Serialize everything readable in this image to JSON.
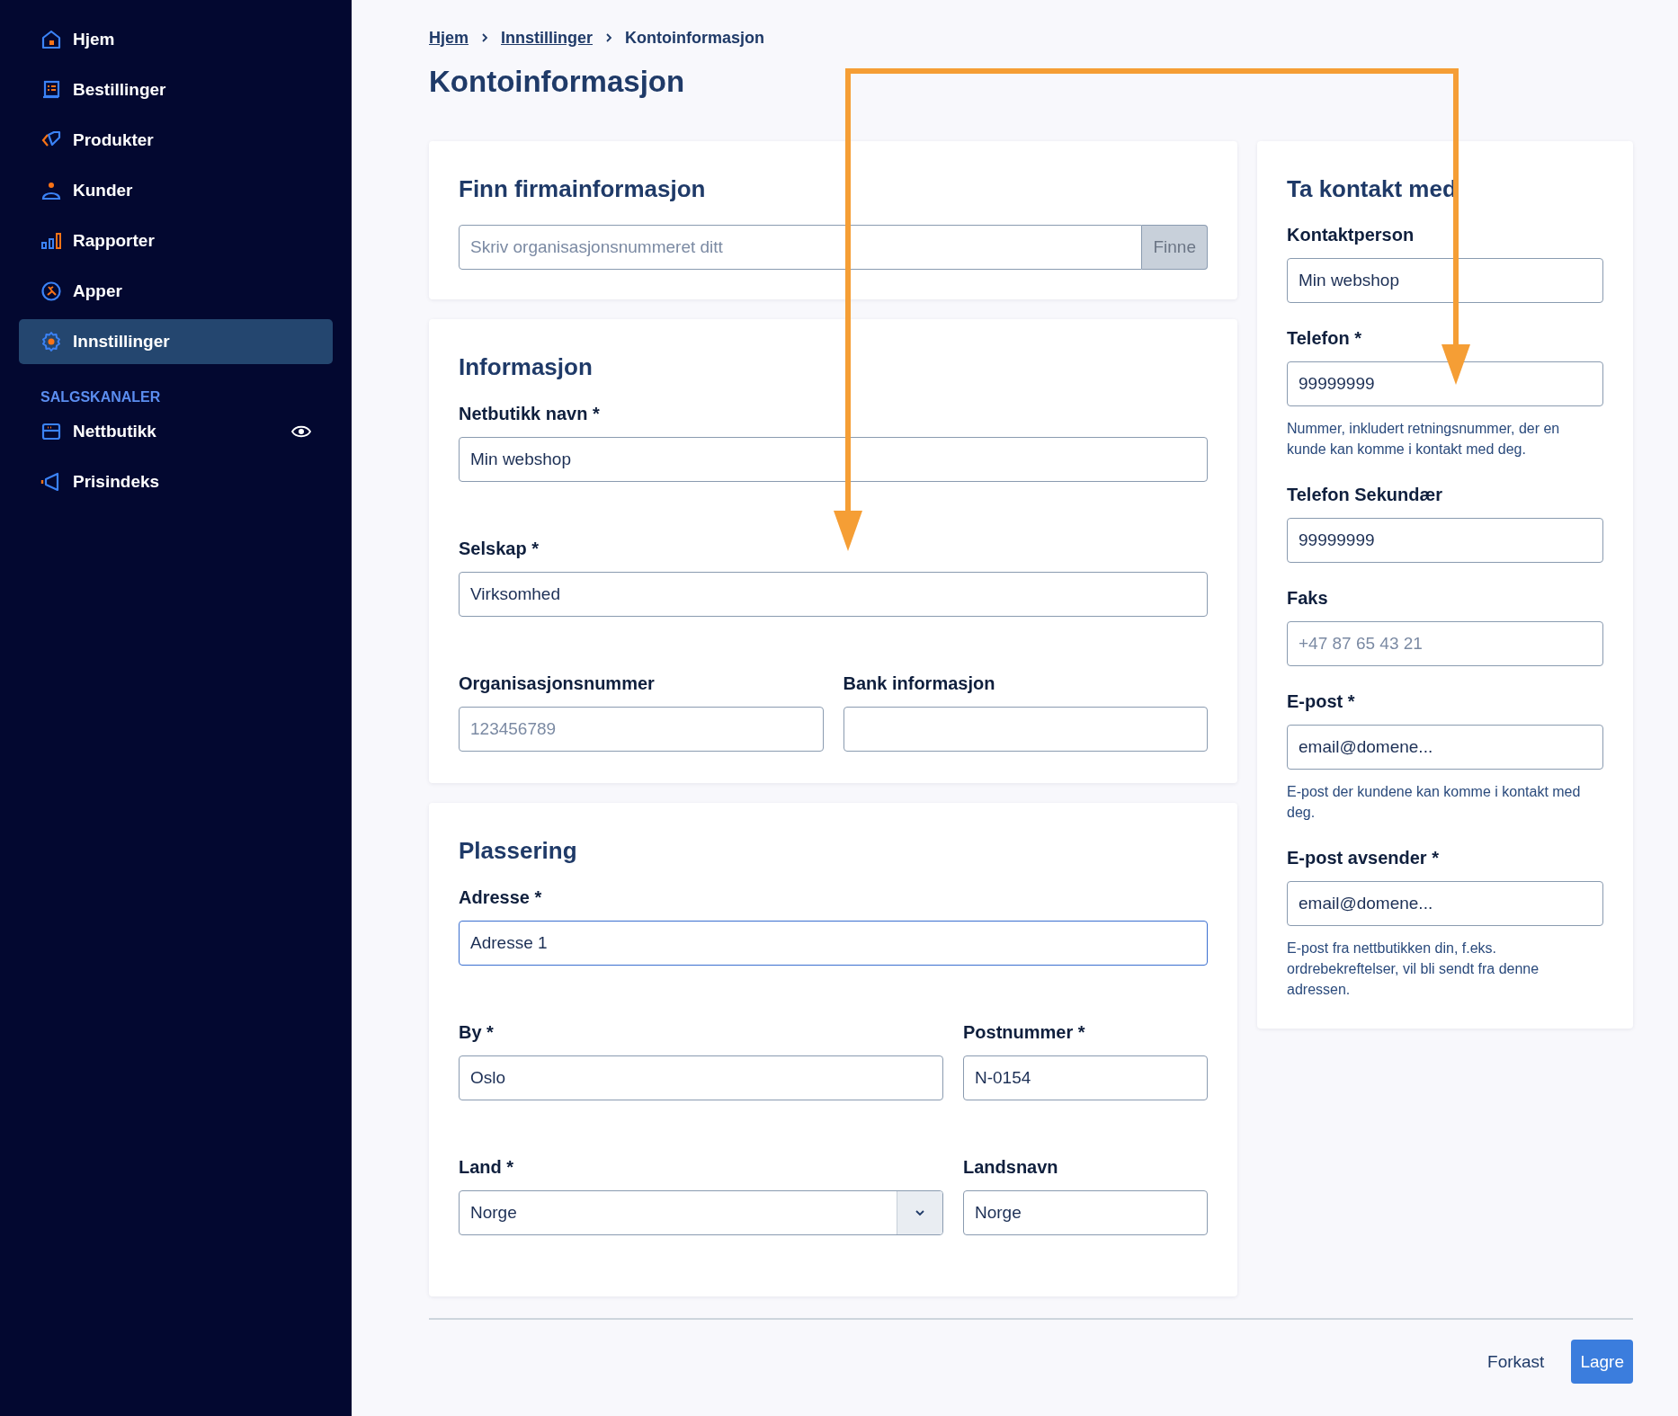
{
  "sidebar": {
    "items": [
      {
        "label": "Hjem",
        "selected": false
      },
      {
        "label": "Bestillinger",
        "selected": false
      },
      {
        "label": "Produkter",
        "selected": false
      },
      {
        "label": "Kunder",
        "selected": false
      },
      {
        "label": "Rapporter",
        "selected": false
      },
      {
        "label": "Apper",
        "selected": false
      },
      {
        "label": "Innstillinger",
        "selected": true
      }
    ],
    "section_title": "SALGSKANALER",
    "channels": [
      {
        "label": "Nettbutikk",
        "selected": false
      },
      {
        "label": "Prisindeks",
        "selected": false
      }
    ]
  },
  "breadcrumb": [
    {
      "label": "Hjem",
      "link": true
    },
    {
      "label": "Innstillinger",
      "link": true
    },
    {
      "label": "Kontoinformasjon",
      "link": false
    }
  ],
  "page_title": "Kontoinformasjon",
  "sections": [
    {
      "title": "Finn firmainformasjon",
      "rows": [
        [
          {
            "kind": "search",
            "placeholder": "Skriv organisasjonsnummeret ditt",
            "button": "Finne"
          }
        ]
      ]
    },
    {
      "title": "Informasjon",
      "rows": [
        [
          {
            "kind": "text",
            "label": "Netbutikk navn *",
            "value": "Min webshop",
            "focused": false
          }
        ],
        [
          {
            "kind": "text",
            "label": "Selskap *",
            "value": "Virksomhed",
            "focused": false
          }
        ],
        [
          {
            "kind": "text",
            "label": "Organisasjonsnummer",
            "placeholder": "123456789",
            "focused": false
          },
          {
            "kind": "text",
            "label": "Bank informasjon",
            "focused": false
          }
        ]
      ]
    },
    {
      "title": "Plassering",
      "rows": [
        [
          {
            "kind": "text",
            "label": "Adresse *",
            "value": "Adresse 1",
            "focused": true
          }
        ],
        [
          {
            "kind": "text",
            "label": "By *",
            "value": "Oslo",
            "focused": false
          },
          {
            "kind": "text",
            "label": "Postnummer *",
            "value": "N-0154",
            "focused": false
          }
        ],
        [
          {
            "kind": "select",
            "label": "Land *",
            "value": "Norge",
            "focused": false
          },
          {
            "kind": "text",
            "label": "Landsnavn",
            "value": "Norge",
            "focused": false
          }
        ]
      ]
    }
  ],
  "contact": {
    "title": "Ta kontakt med",
    "fields": [
      {
        "kind": "text",
        "label": "Kontaktperson",
        "value": "Min webshop",
        "focused": false
      },
      {
        "kind": "text",
        "label": "Telefon *",
        "value": "99999999",
        "focused": false,
        "help": "Nummer, inkludert retningsnummer, der en kunde kan komme i kontakt med deg."
      },
      {
        "kind": "text",
        "label": "Telefon Sekundær",
        "value": "99999999",
        "focused": false
      },
      {
        "kind": "text",
        "label": "Faks",
        "placeholder": "+47 87 65 43 21",
        "focused": false
      },
      {
        "kind": "text",
        "label": "E-post *",
        "value": "email@domene...",
        "focused": false,
        "help": "E-post der kundene kan komme i kontakt med deg."
      },
      {
        "kind": "text",
        "label": "E-post avsender *",
        "value": "email@domene...",
        "focused": false,
        "help": "E-post fra nettbutikken din, f.eks. ordrebekreftelser, vil bli sendt fra denne adressen."
      }
    ]
  },
  "footer": {
    "cancel": "Forkast",
    "save": "Lagre"
  }
}
